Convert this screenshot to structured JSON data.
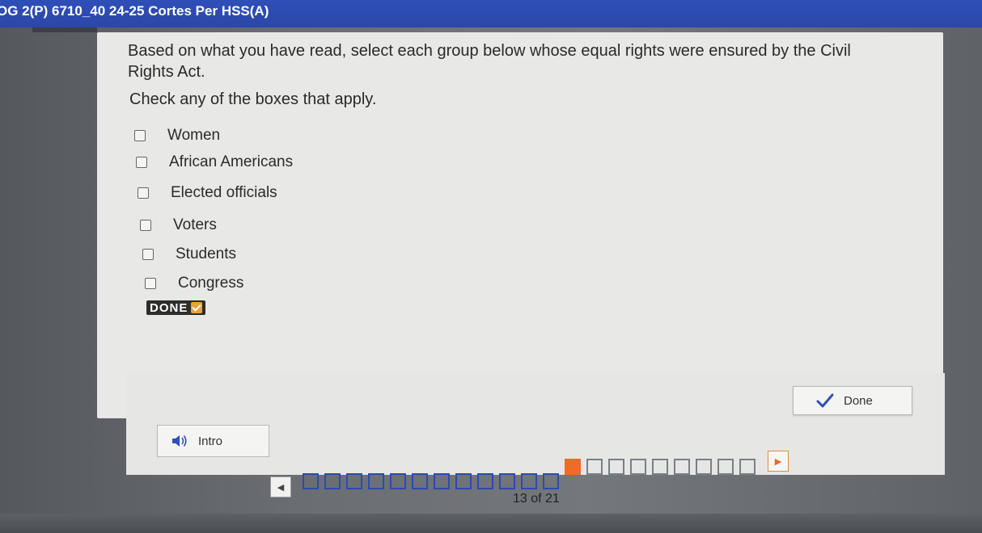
{
  "header": {
    "title": "OG 2(P) 6710_40 24-25 Cortes Per HSS(A)"
  },
  "question": {
    "prompt": "Based on what you have read, select each group below whose equal rights were ensured by the Civil Rights Act.",
    "instruction": "Check any of the boxes that apply."
  },
  "options": [
    {
      "label": "Women",
      "checked": false
    },
    {
      "label": "African Americans",
      "checked": false
    },
    {
      "label": "Elected officials",
      "checked": false
    },
    {
      "label": "Voters",
      "checked": false
    },
    {
      "label": "Students",
      "checked": false
    },
    {
      "label": "Congress",
      "checked": false
    }
  ],
  "done_badge": {
    "label": "DONE"
  },
  "buttons": {
    "done_label": "Done",
    "intro_label": "Intro"
  },
  "progress": {
    "current": 13,
    "total": 21,
    "label": "13 of 21"
  },
  "colors": {
    "header": "#2f4fb8",
    "current_page": "#f06a2a",
    "done_check": "#e8a43a",
    "page_box": "#2b4bb0"
  },
  "icons": {
    "done_button": "checkmark-icon",
    "intro_button": "speaker-icon",
    "prev": "chevron-left-icon",
    "next": "chevron-right-icon"
  }
}
